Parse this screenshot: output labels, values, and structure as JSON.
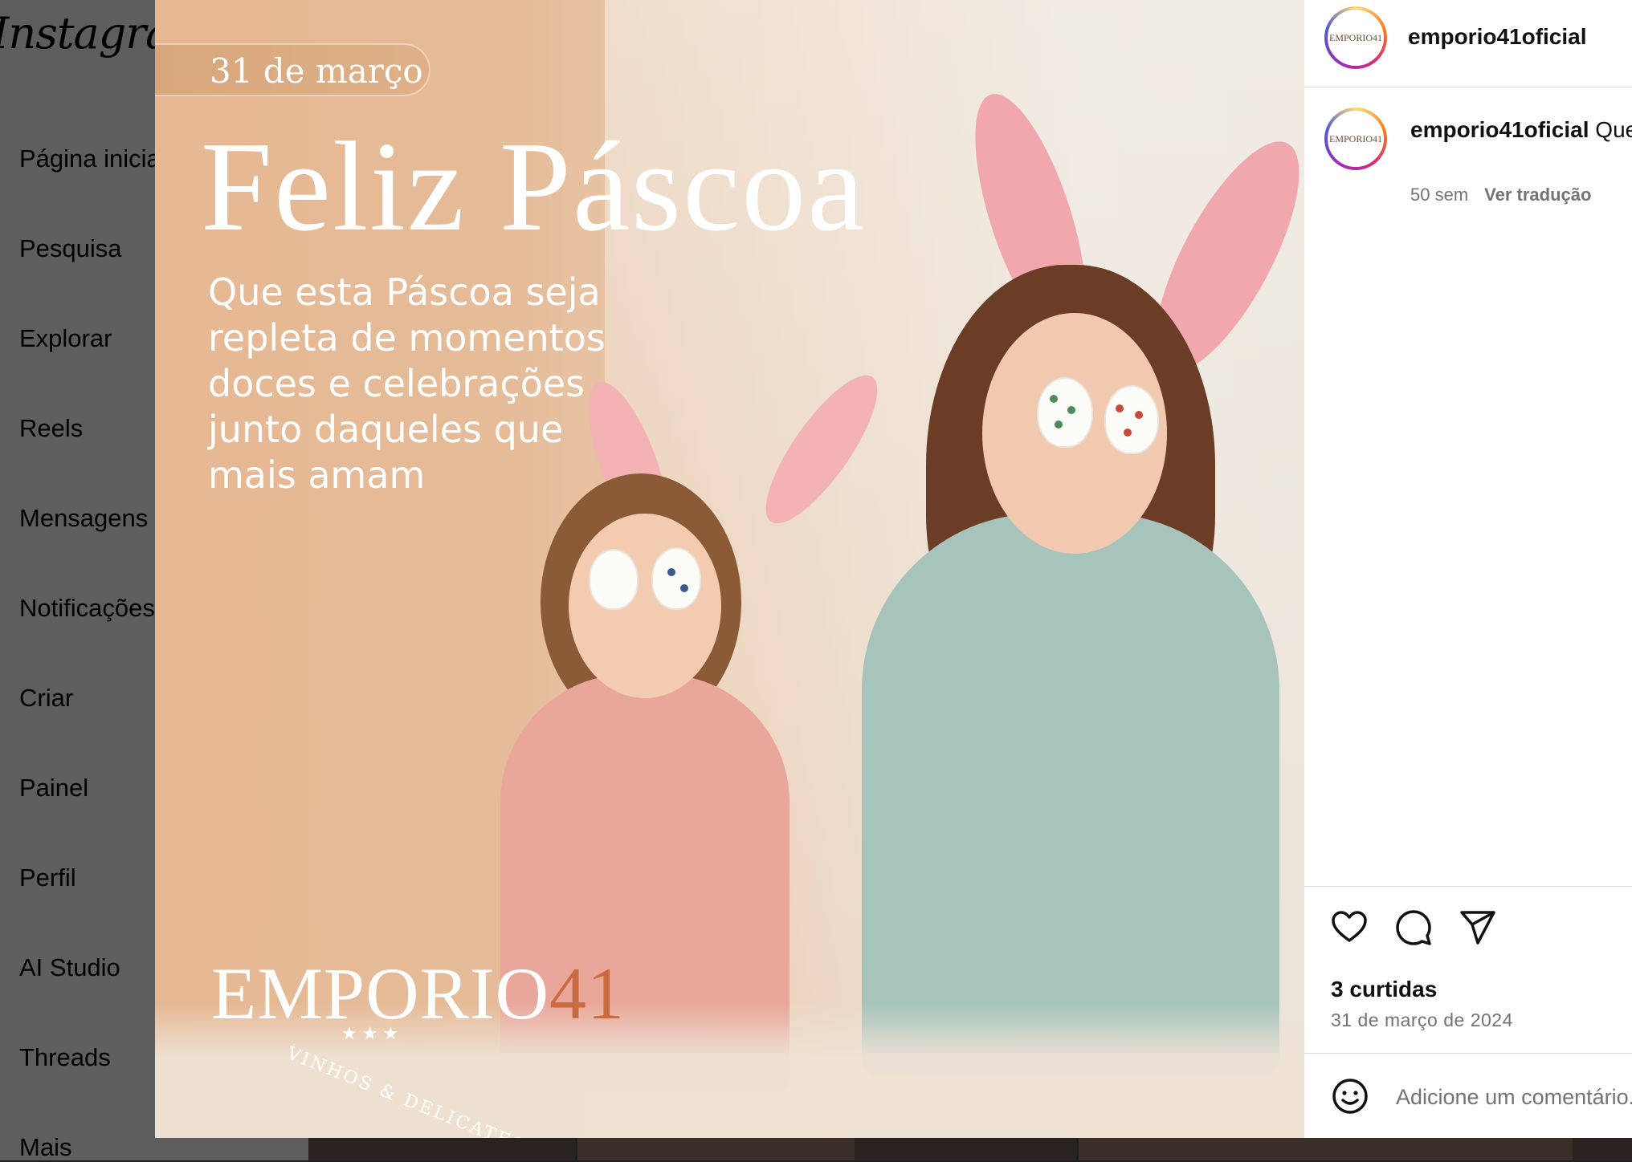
{
  "sidebar": {
    "logo": "Instagram",
    "items": [
      {
        "label": "Página inicial"
      },
      {
        "label": "Pesquisa"
      },
      {
        "label": "Explorar"
      },
      {
        "label": "Reels"
      },
      {
        "label": "Mensagens"
      },
      {
        "label": "Notificações"
      },
      {
        "label": "Criar"
      },
      {
        "label": "Painel"
      },
      {
        "label": "Perfil"
      },
      {
        "label": "AI Studio"
      },
      {
        "label": "Threads"
      },
      {
        "label": "Mais"
      }
    ]
  },
  "post_image": {
    "date_badge": "31 de março",
    "headline": "Feliz Páscoa",
    "message": "Que esta Páscoa seja repleta de momentos doces e celebrações junto daqueles que mais amam",
    "brand_name": "EMPORIO",
    "brand_number": "41",
    "brand_stars": "★★★",
    "brand_tagline": "VINHOS & DELICATESSEN",
    "brand_number_color": "#c96a3f"
  },
  "post": {
    "username": "emporio41oficial",
    "avatar_text": "EMPORIO41",
    "caption_user": "emporio41oficial",
    "caption_text": "Que esta Páscoa seja um momento de celebração e renovação",
    "caption_age": "50 sem",
    "translate_label": "Ver tradução",
    "likes": "3 curtidas",
    "date": "31 de março de 2024",
    "comment_placeholder": "Adicione um comentário..."
  },
  "icons": {
    "like": "heart-icon",
    "comment": "comment-icon",
    "share": "send-icon",
    "emoji": "emoji-icon"
  }
}
